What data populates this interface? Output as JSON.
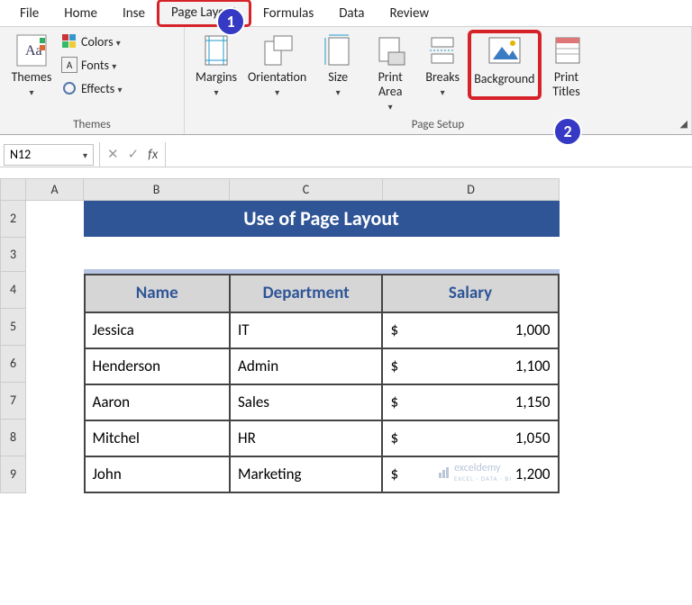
{
  "tabs": {
    "file": "File",
    "home": "Home",
    "insert": "Inse",
    "page_layout": "Page Layout",
    "formulas": "Formulas",
    "data": "Data",
    "review": "Review"
  },
  "ribbon": {
    "themes": {
      "themes_btn": "Themes",
      "colors": "Colors",
      "fonts": "Fonts",
      "effects": "Effects",
      "group": "Themes"
    },
    "pagesetup": {
      "margins": "Margins",
      "orientation": "Orientation",
      "size": "Size",
      "printarea": "Print\nArea",
      "breaks": "Breaks",
      "background": "Background",
      "printtitles": "Print\nTitles",
      "group": "Page Setup"
    }
  },
  "callouts": {
    "one": "1",
    "two": "2"
  },
  "namebox": "N12",
  "cols": {
    "A": "A",
    "B": "B",
    "C": "C",
    "D": "D"
  },
  "rows": {
    "r2": "2",
    "r3": "3",
    "r4": "4",
    "r5": "5",
    "r6": "6",
    "r7": "7",
    "r8": "8",
    "r9": "9"
  },
  "title": "Use of Page Layout",
  "headers": {
    "name": "Name",
    "dept": "Department",
    "salary": "Salary"
  },
  "cur": "$",
  "data_rows": {
    "r0": {
      "name": "Jessica",
      "dept": "IT",
      "salary": "1,000"
    },
    "r1": {
      "name": "Henderson",
      "dept": "Admin",
      "salary": "1,100"
    },
    "r2": {
      "name": "Aaron",
      "dept": "Sales",
      "salary": "1,150"
    },
    "r3": {
      "name": "Mitchel",
      "dept": "HR",
      "salary": "1,050"
    },
    "r4": {
      "name": "John",
      "dept": "Marketing",
      "salary": "1,200"
    }
  },
  "watermark": {
    "brand": "exceldemy",
    "sub": "EXCEL · DATA · BI"
  }
}
